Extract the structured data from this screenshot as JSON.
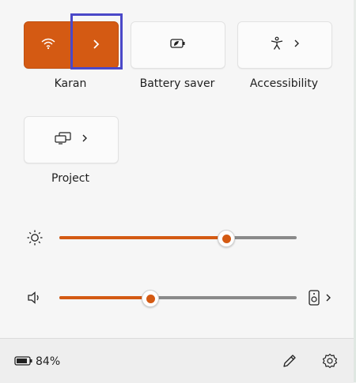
{
  "tiles": {
    "wifi": {
      "label": "Karan"
    },
    "battery_saver": {
      "label": "Battery saver"
    },
    "accessibility": {
      "label": "Accessibility"
    },
    "project": {
      "label": "Project"
    }
  },
  "sliders": {
    "brightness": {
      "value": 0.7
    },
    "volume": {
      "value": 0.38
    }
  },
  "footer": {
    "battery_percent": "84%"
  },
  "colors": {
    "accent": "#d45a13",
    "track_inactive": "#8a8a8a"
  },
  "icons": [
    "wifi-icon",
    "chevron-right-icon",
    "battery-saver-icon",
    "accessibility-icon",
    "project-icon",
    "brightness-icon",
    "volume-icon",
    "audio-output-icon",
    "battery-icon",
    "edit-icon",
    "settings-icon"
  ]
}
